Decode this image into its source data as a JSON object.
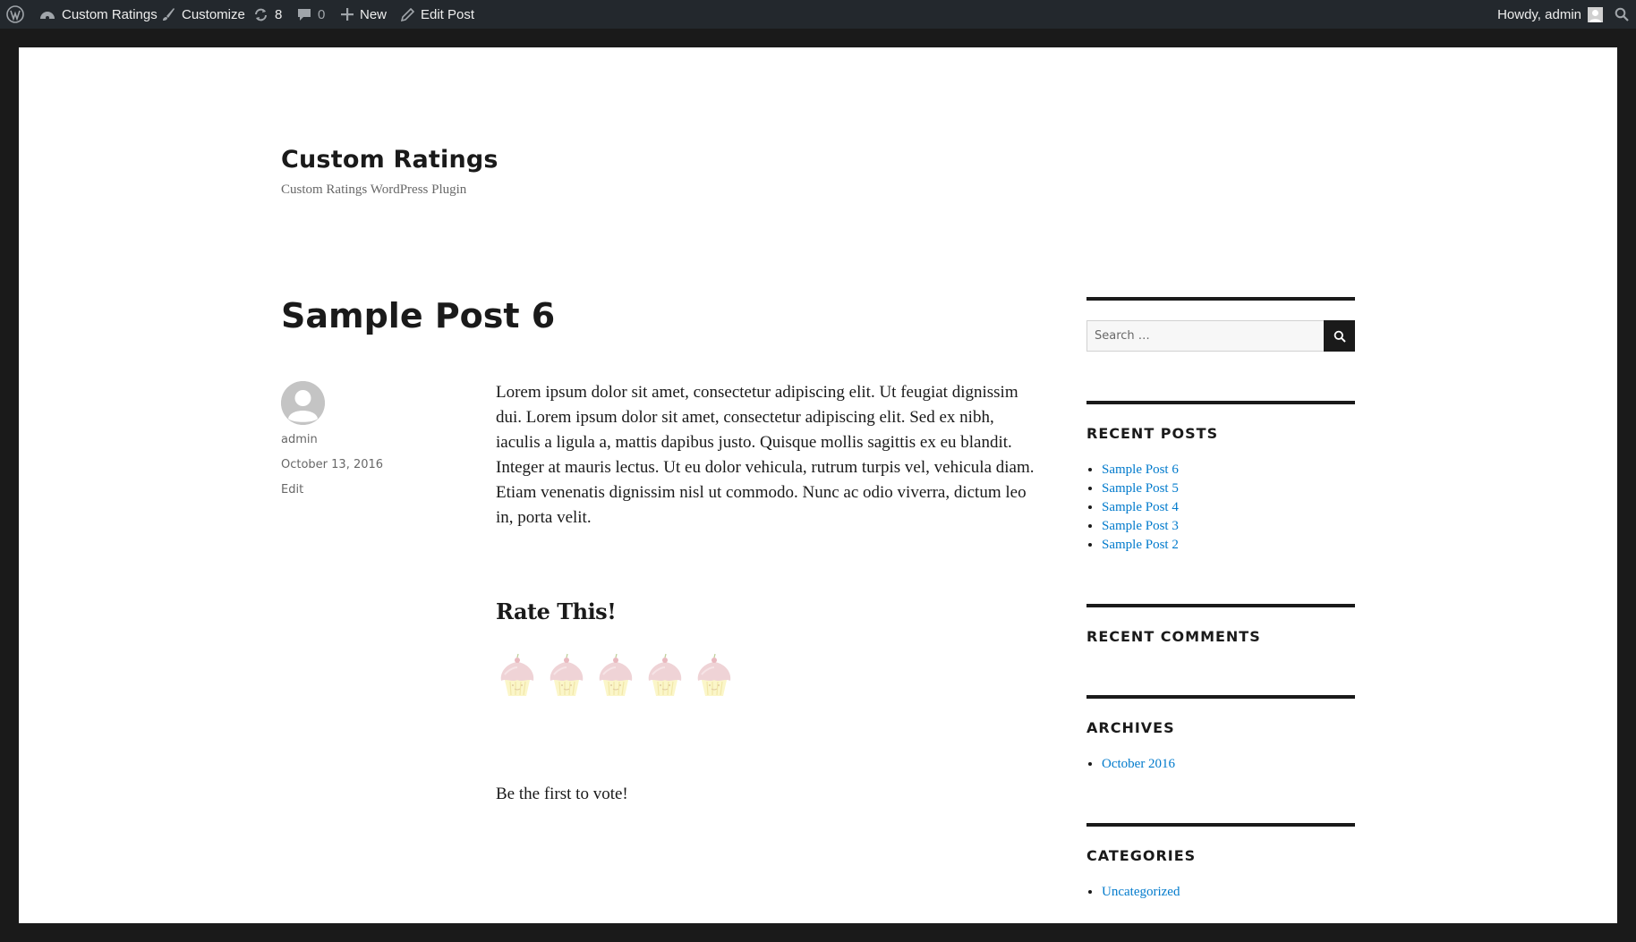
{
  "adminbar": {
    "site_name": "Custom Ratings",
    "customize": "Customize",
    "updates_count": "8",
    "comments_count": "0",
    "new_label": "New",
    "edit_post": "Edit Post",
    "howdy": "Howdy, admin"
  },
  "site": {
    "title": "Custom Ratings",
    "description": "Custom Ratings WordPress Plugin"
  },
  "post": {
    "title": "Sample Post 6",
    "author": "admin",
    "date": "October 13, 2016",
    "edit": "Edit",
    "body": "Lorem ipsum dolor sit amet, consectetur adipiscing elit. Ut feugiat dignissim dui. Lorem ipsum dolor sit amet, consectetur adipiscing elit. Sed ex nibh, iaculis a ligula a, mattis dapibus justo. Quisque mollis sagittis ex eu blandit. Integer at mauris lectus. Ut eu dolor vehicula, rutrum turpis vel, vehicula diam. Etiam venenatis dignissim nisl ut commodo. Nunc ac odio viverra, dictum leo in, porta velit."
  },
  "rating": {
    "title": "Rate This!",
    "icon": "cupcake-icon",
    "max": 5,
    "current": 0,
    "vote_text": "Be the first to vote!"
  },
  "sidebar": {
    "search_placeholder": "Search …",
    "recent_posts_title": "RECENT POSTS",
    "recent_posts": [
      "Sample Post 6",
      "Sample Post 5",
      "Sample Post 4",
      "Sample Post 3",
      "Sample Post 2"
    ],
    "recent_comments_title": "RECENT COMMENTS",
    "archives_title": "ARCHIVES",
    "archives": [
      "October 2016"
    ],
    "categories_title": "CATEGORIES",
    "categories": [
      "Uncategorized"
    ]
  },
  "colors": {
    "adminbar_bg": "#23282d",
    "frame_bg": "#1a1a1a",
    "link": "#007acc",
    "text": "#1a1a1a",
    "meta": "#686868"
  }
}
